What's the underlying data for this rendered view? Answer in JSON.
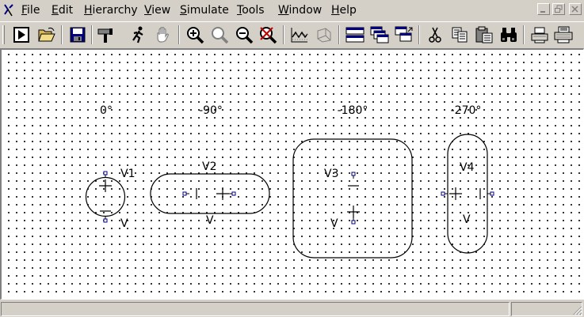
{
  "menubar": {
    "items": [
      {
        "accel": "F",
        "rest": "ile"
      },
      {
        "accel": "E",
        "rest": "dit"
      },
      {
        "accel": "H",
        "rest": "ierarchy"
      },
      {
        "accel": "V",
        "rest": "iew"
      },
      {
        "accel": "S",
        "rest": "imulate"
      },
      {
        "accel": "T",
        "rest": "ools"
      },
      {
        "accel": "W",
        "rest": "indow"
      },
      {
        "accel": "H",
        "rest": "elp"
      }
    ]
  },
  "toolbar": {
    "buttons": [
      "new",
      "open",
      "save",
      "build",
      "run",
      "pan",
      "zoom-in",
      "zoom-fit",
      "zoom-out",
      "zoom-cancel",
      "plot",
      "probe",
      "window-tile",
      "window-cascade",
      "window-arrange",
      "cut",
      "copy",
      "paste",
      "find",
      "print-preview",
      "print"
    ]
  },
  "canvas": {
    "angle_labels": [
      "0°",
      "-90°",
      "-180°",
      "-270°"
    ],
    "components": [
      {
        "ref": "V1",
        "value": "V"
      },
      {
        "ref": "V2",
        "value": "V"
      },
      {
        "ref": "V3",
        "value": "V"
      },
      {
        "ref": "V4",
        "value": "V"
      }
    ]
  },
  "statusbar": {
    "panes": [
      "",
      ""
    ]
  },
  "colors": {
    "chrome": "#d4d0c8",
    "canvas": "#ffffff",
    "pin": "#000080",
    "toolbar_blue": "#000080"
  }
}
